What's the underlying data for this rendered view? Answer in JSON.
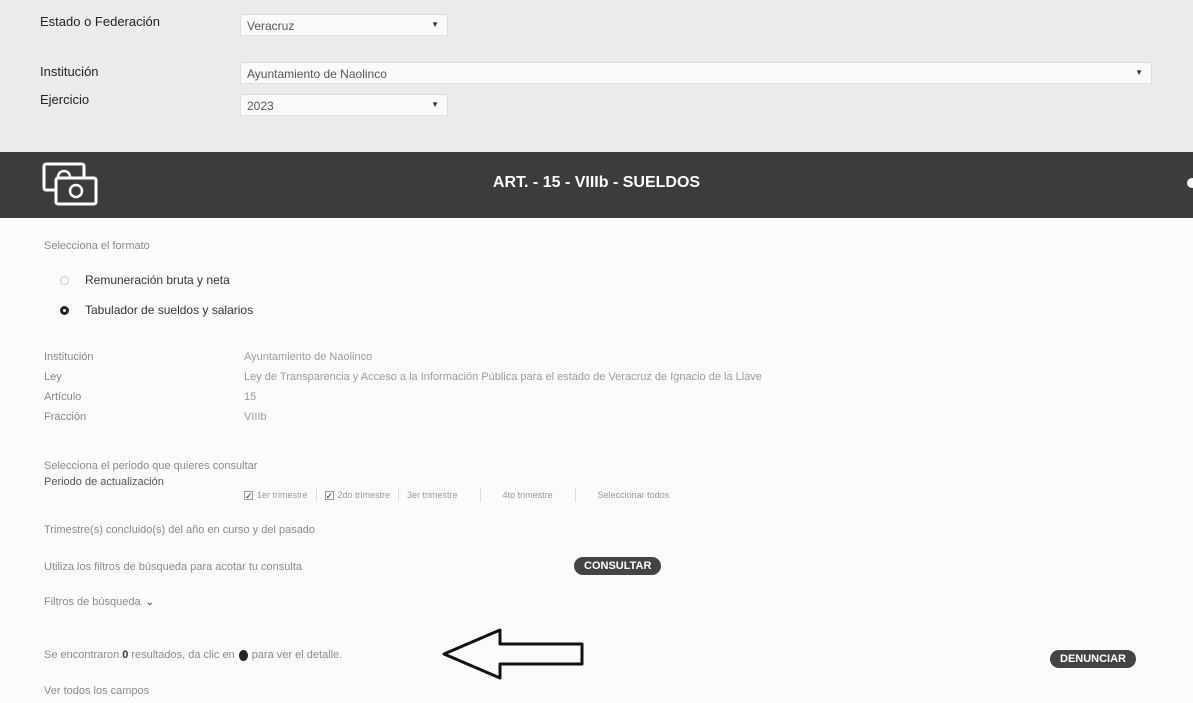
{
  "filters": {
    "estado_label": "Estado o Federación",
    "estado_value": "Veracruz",
    "institucion_label": "Institución",
    "institucion_value": "Ayuntamiento de Naolinco",
    "ejercicio_label": "Ejercicio",
    "ejercicio_value": "2023"
  },
  "banner": {
    "title": "ART. - 15 - VIIIb - SUELDOS",
    "icon": "money-bills-icon"
  },
  "formato": {
    "prompt": "Selecciona el formato",
    "options": [
      {
        "label": "Remuneración bruta y neta",
        "selected": false
      },
      {
        "label": "Tabulador de sueldos y salarios",
        "selected": true
      }
    ]
  },
  "info": {
    "institucion_label": "Institución",
    "institucion_value": "Ayuntamiento de Naolinco",
    "ley_label": "Ley",
    "ley_value": "Ley de Transparencia y Acceso a la Información Pública para el estado de Veracruz de Ignacio de la Llave",
    "articulo_label": "Artículo",
    "articulo_value": "15",
    "fraccion_label": "Fracción",
    "fraccion_value": "VIIIb"
  },
  "periodo": {
    "prompt": "Selecciona el periodo que quieres consultar",
    "label": "Periodo de actualización",
    "options": [
      {
        "label": "1er trimestre",
        "checked": true
      },
      {
        "label": "2do trimestre",
        "checked": true
      },
      {
        "label": "3er trimestre",
        "checked": false
      },
      {
        "label": "4to trimestre",
        "checked": false
      },
      {
        "label": "Seleccionar todos",
        "checked": false
      }
    ],
    "note": "Trimestre(s) concluido(s) del año en curso y del pasado"
  },
  "consulta": {
    "hint": "Utiliza los filtros de búsqueda para acotar tu consulta",
    "button": "CONSULTAR",
    "filters_toggle": "Filtros de búsqueda"
  },
  "results": {
    "prefix": "Se encontraron",
    "count": "0",
    "middle": "resultados, da clic en",
    "suffix": "para ver el detalle.",
    "denunciar": "DENUNCIAR",
    "ver_todos": "Ver todos los campos"
  }
}
